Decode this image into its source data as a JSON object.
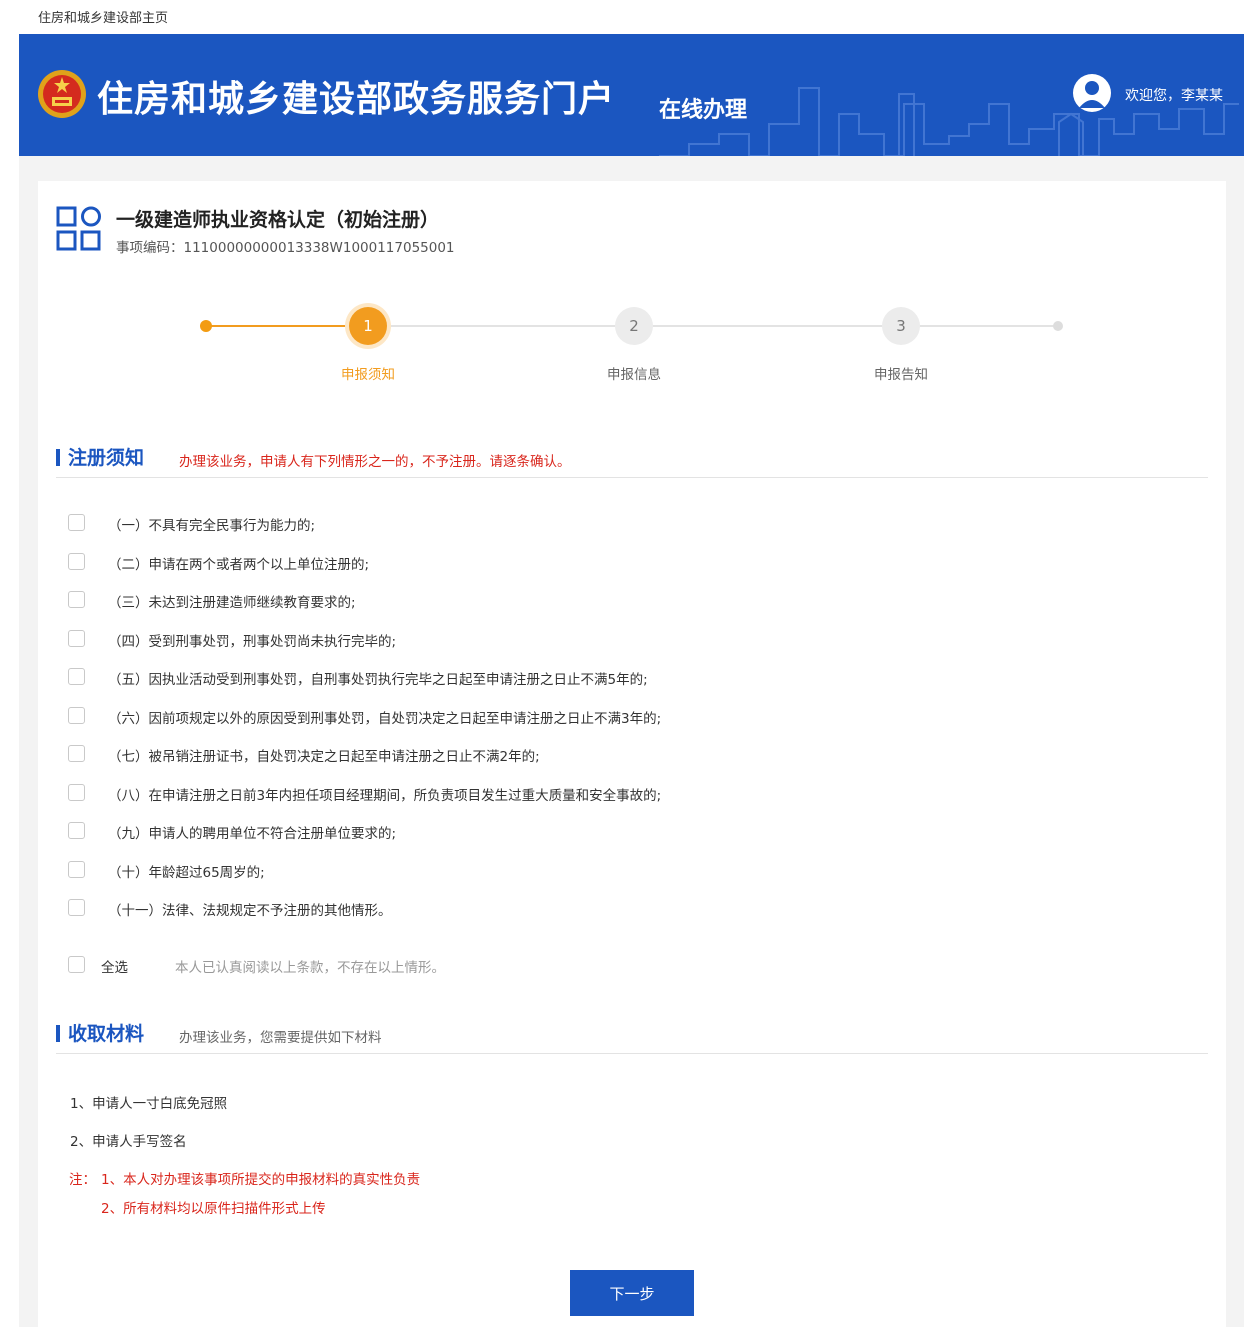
{
  "top_link": "住房和城乡建设部主页",
  "header": {
    "title": "住房和城乡建设部政务服务门户",
    "subtitle": "在线办理",
    "welcome": "欢迎您，李某某",
    "brand_color": "#1b56c0"
  },
  "item": {
    "title": "一级建造师执业资格认定（初始注册）",
    "code_label": "事项编码：",
    "code": "11100000000013338W1000117055001"
  },
  "steps": [
    {
      "number": "1",
      "label": "申报须知",
      "state": "active"
    },
    {
      "number": "2",
      "label": "申报信息",
      "state": "inactive"
    },
    {
      "number": "3",
      "label": "申报告知",
      "state": "inactive"
    }
  ],
  "notice": {
    "title": "注册须知",
    "warning": "办理该业务，申请人有下列情形之一的，不予注册。请逐条确认。",
    "conditions": [
      "（一）不具有完全民事行为能力的;",
      "（二）申请在两个或者两个以上单位注册的;",
      "（三）未达到注册建造师继续教育要求的;",
      "（四）受到刑事处罚，刑事处罚尚未执行完毕的;",
      "（五）因执业活动受到刑事处罚，自刑事处罚执行完毕之日起至申请注册之日止不满5年的;",
      "（六）因前项规定以外的原因受到刑事处罚，自处罚决定之日起至申请注册之日止不满3年的;",
      "（七）被吊销注册证书，自处罚决定之日起至申请注册之日止不满2年的;",
      "（八）在申请注册之日前3年内担任项目经理期间，所负责项目发生过重大质量和安全事故的;",
      "（九）申请人的聘用单位不符合注册单位要求的;",
      "（十）年龄超过65周岁的;",
      "（十一）法律、法规规定不予注册的其他情形。"
    ],
    "select_all_label": "全选",
    "select_all_hint": "本人已认真阅读以上条款，不存在以上情形。"
  },
  "materials": {
    "title": "收取材料",
    "subtitle": "办理该业务，您需要提供如下材料",
    "items": [
      "1、申请人一寸白底免冠照",
      "2、申请人手写签名"
    ],
    "note_prefix": "注：",
    "notes": [
      "1、本人对办理该事项所提交的申报材料的真实性负责",
      "2、所有材料均以原件扫描件形式上传"
    ]
  },
  "next_button": "下一步"
}
